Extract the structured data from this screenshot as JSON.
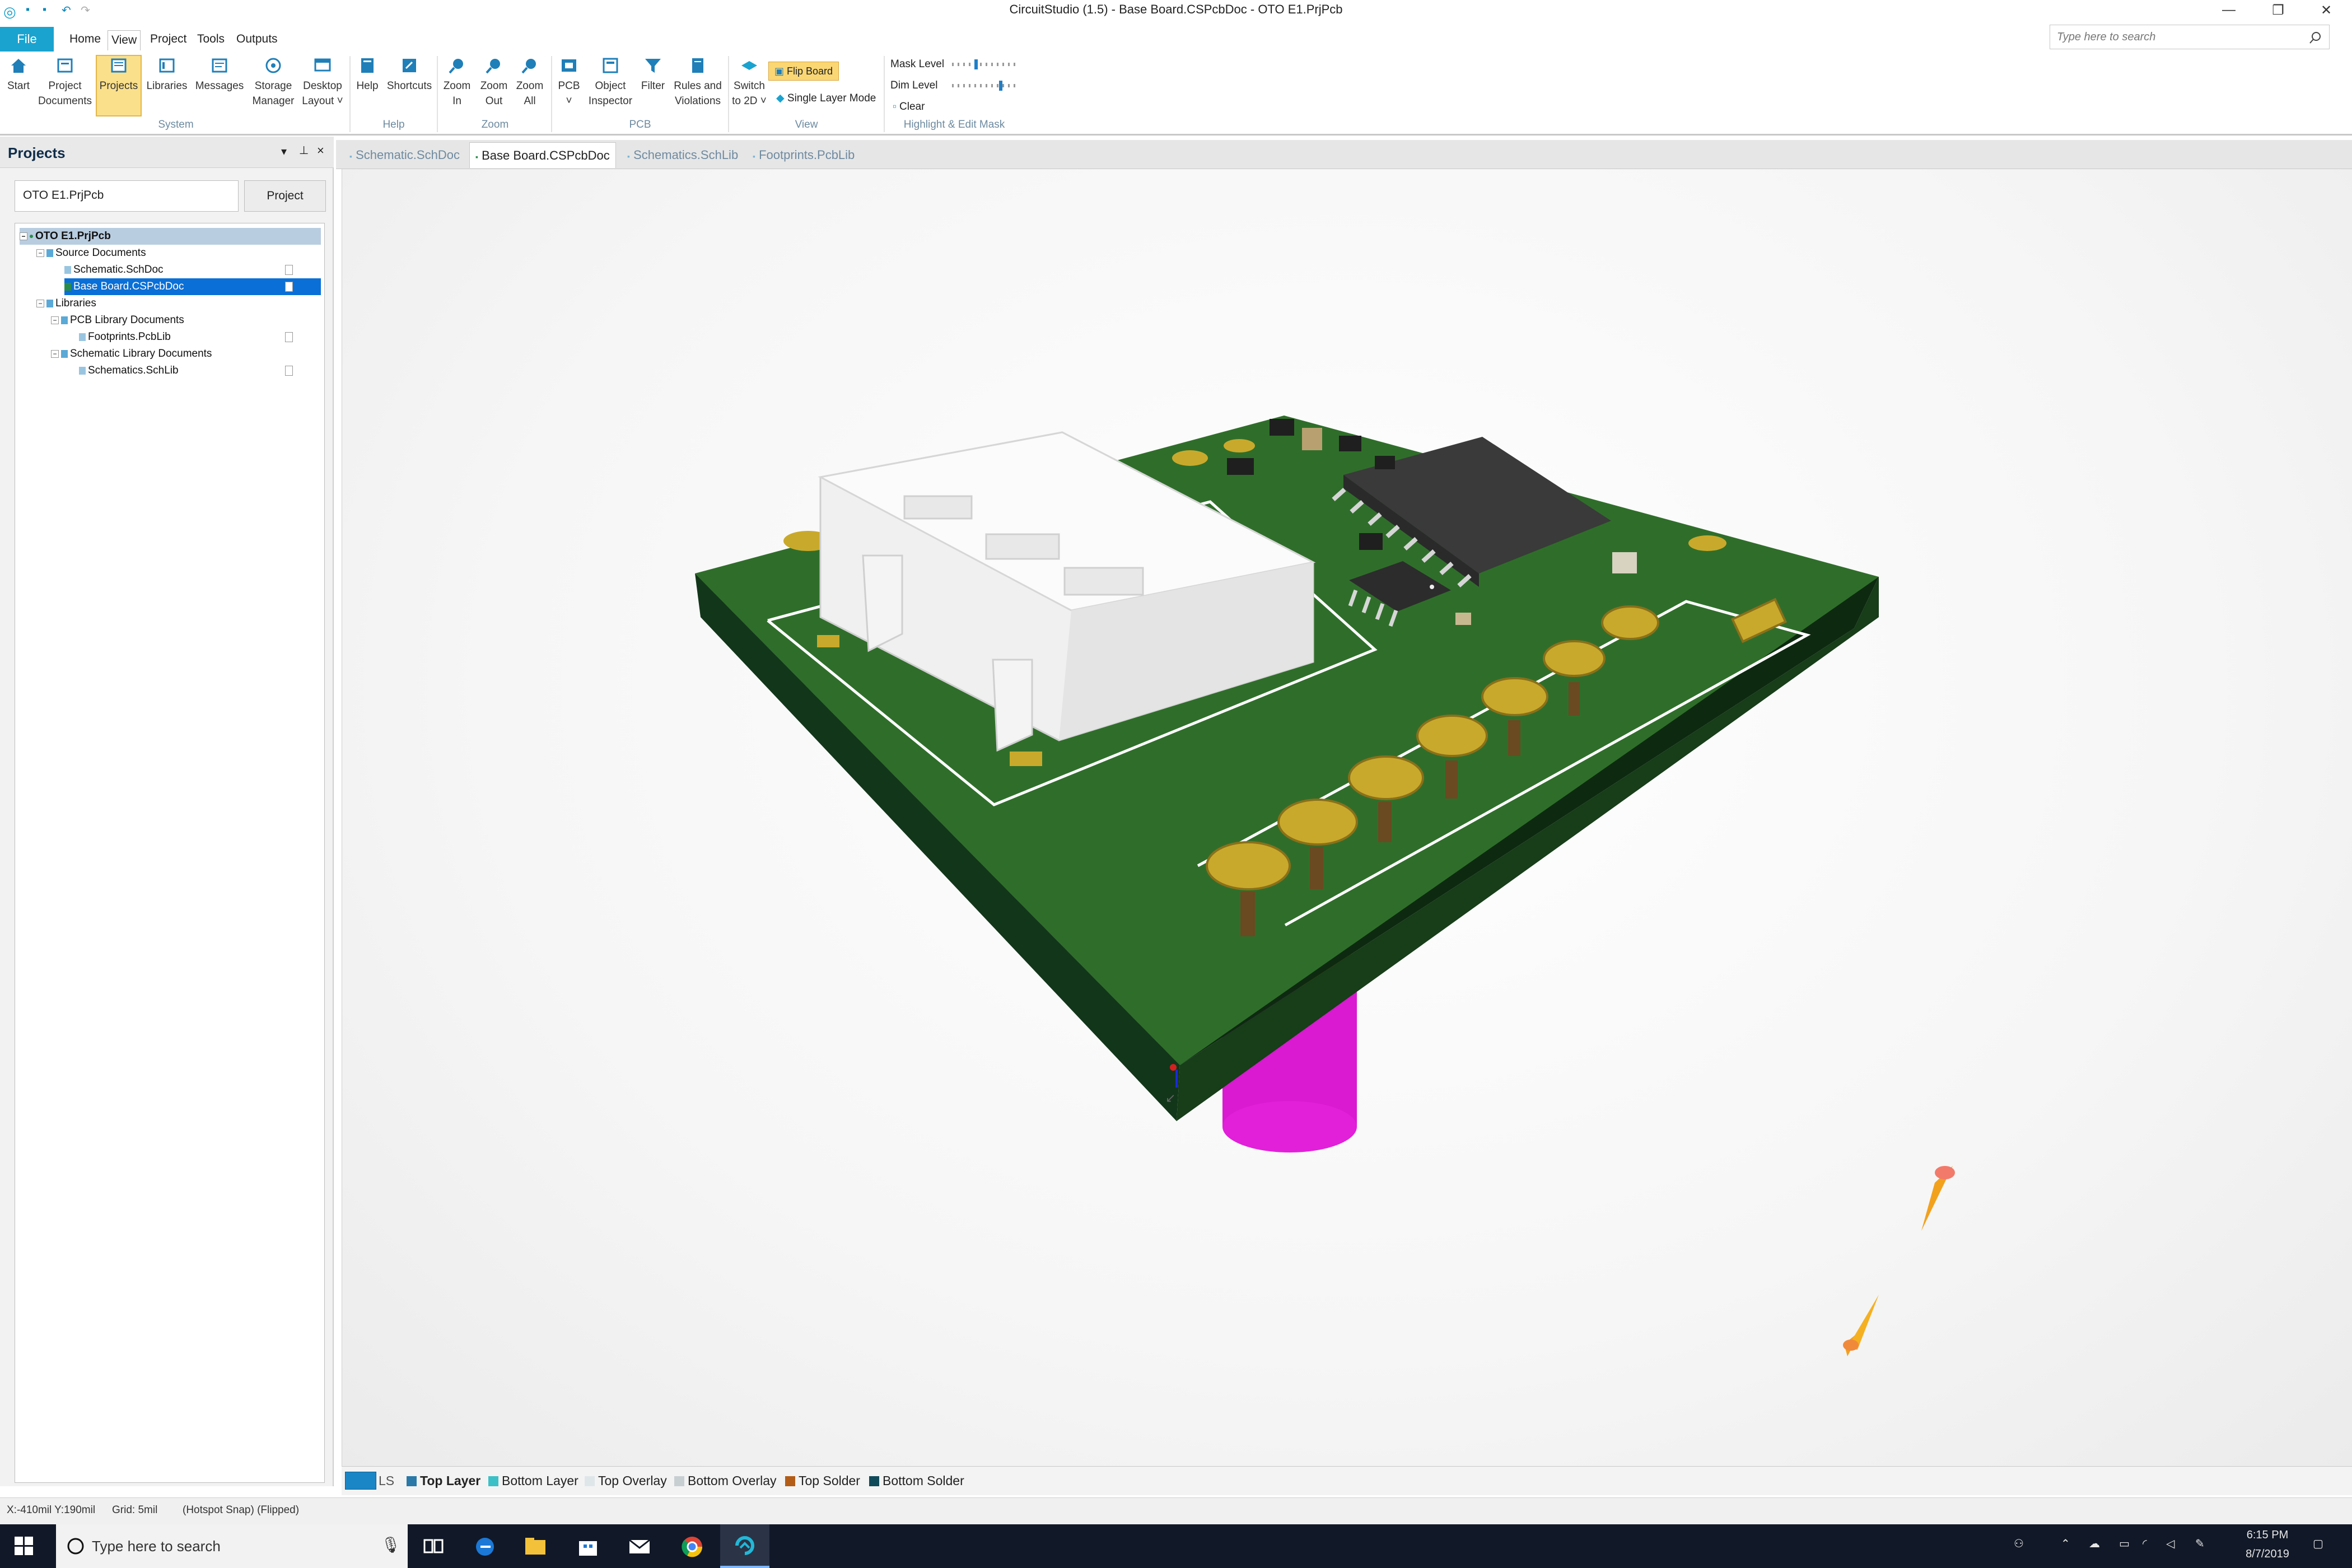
{
  "window": {
    "title": "CircuitStudio (1.5) - Base Board.CSPcbDoc - OTO E1.PrjPcb",
    "minimize": "—",
    "restore": "❐",
    "close": "✕"
  },
  "menu": {
    "file": "File",
    "home": "Home",
    "view": "View",
    "project": "Project",
    "tools": "Tools",
    "outputs": "Outputs"
  },
  "search": {
    "placeholder": "Type here to search"
  },
  "ribbon": {
    "start": "Start",
    "project_documents_1": "Project",
    "project_documents_2": "Documents",
    "projects": "Projects",
    "libraries": "Libraries",
    "messages": "Messages",
    "storage_1": "Storage",
    "storage_2": "Manager",
    "desktop_1": "Desktop",
    "desktop_2": "Layout ˅",
    "help": "Help",
    "shortcuts": "Shortcuts",
    "zoom_in_1": "Zoom",
    "zoom_in_2": "In",
    "zoom_out_1": "Zoom",
    "zoom_out_2": "Out",
    "zoom_all_1": "Zoom",
    "zoom_all_2": "All",
    "pcb_1": "PCB",
    "pcb_2": "˅",
    "object_1": "Object",
    "object_2": "Inspector",
    "filter": "Filter",
    "rules_1": "Rules and",
    "rules_2": "Violations",
    "switch_1": "Switch",
    "switch_2": "to 2D ˅",
    "flip_board": "Flip Board",
    "single_layer": "Single Layer Mode",
    "mask_level": "Mask Level",
    "dim_level": "Dim Level",
    "clear": "Clear",
    "groups": {
      "system": "System",
      "help": "Help",
      "zoom": "Zoom",
      "pcb": "PCB",
      "view": "View",
      "highlight": "Highlight & Edit Mask"
    }
  },
  "panel": {
    "title": "Projects",
    "project_value": "OTO E1.PrjPcb",
    "project_button": "Project",
    "tree": [
      {
        "label": "OTO E1.PrjPcb"
      },
      {
        "label": "Source Documents"
      },
      {
        "label": "Schematic.SchDoc"
      },
      {
        "label": "Base Board.CSPcbDoc"
      },
      {
        "label": "Libraries"
      },
      {
        "label": "PCB Library Documents"
      },
      {
        "label": "Footprints.PcbLib"
      },
      {
        "label": "Schematic Library Documents"
      },
      {
        "label": "Schematics.SchLib"
      }
    ]
  },
  "tabs": [
    {
      "label": "Schematic.SchDoc"
    },
    {
      "label": "Base Board.CSPcbDoc"
    },
    {
      "label": "Schematics.SchLib"
    },
    {
      "label": "Footprints.PcbLib"
    }
  ],
  "layers": {
    "ls": "LS",
    "items": [
      {
        "label": "Top Layer",
        "color": "#2a79a8"
      },
      {
        "label": "Bottom Layer",
        "color": "#3cc0c8"
      },
      {
        "label": "Top Overlay",
        "color": "#dfe6ea"
      },
      {
        "label": "Bottom Overlay",
        "color": "#c8cfd2"
      },
      {
        "label": "Top Solder",
        "color": "#b35c17"
      },
      {
        "label": "Bottom Solder",
        "color": "#0f4a5a"
      }
    ]
  },
  "status": {
    "coords": "X:-410mil Y:190mil",
    "grid": "Grid: 5mil",
    "snap": "(Hotspot Snap) (Flipped)"
  },
  "taskbar": {
    "search": "Type here to search",
    "time": "6:15 PM",
    "date": "8/7/2019"
  },
  "colors": {
    "accent": "#1aa3cf",
    "board_green": "#2f6e2a",
    "pad_gold": "#c9a92b",
    "capacitor_magenta": "#e619d8"
  }
}
